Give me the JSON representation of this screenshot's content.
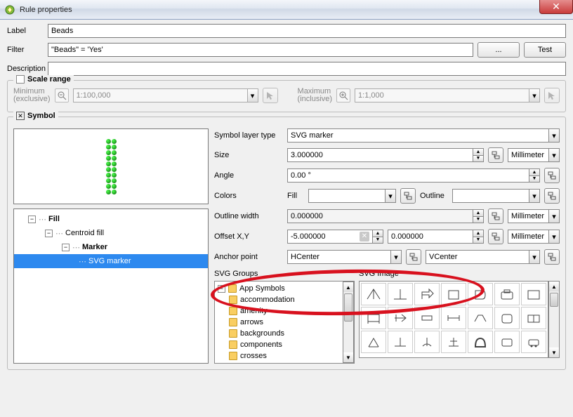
{
  "window": {
    "title": "Rule properties"
  },
  "topbtns": {
    "dots": "...",
    "test": "Test"
  },
  "labels": {
    "label": "Label",
    "filter": "Filter",
    "description": "Description",
    "scale_range": "Scale range",
    "min1": "Minimum",
    "min2": "(exclusive)",
    "max1": "Maximum",
    "max2": "(inclusive)",
    "symbol": "Symbol",
    "symbol_layer_type": "Symbol layer type",
    "size": "Size",
    "angle": "Angle",
    "colors": "Colors",
    "fill": "Fill",
    "outline": "Outline",
    "outline_width": "Outline width",
    "offset": "Offset X,Y",
    "anchor": "Anchor point",
    "svg_groups": "SVG Groups",
    "svg_image": "SVG Image"
  },
  "values": {
    "label": "Beads",
    "filter": "\"Beads\" = 'Yes'",
    "description": "",
    "scale_min": "1:100,000",
    "scale_max": "1:1,000",
    "symbol_layer_type": "SVG marker",
    "size": "3.000000",
    "angle": "0.00 °",
    "outline_width": "0.000000",
    "offset_x": "-5.000000",
    "offset_y": "0.000000",
    "anchor_h": "HCenter",
    "anchor_v": "VCenter",
    "unit": "Millimeter"
  },
  "tree": {
    "fill": "Fill",
    "centroid": "Centroid fill",
    "marker": "Marker",
    "svg_marker": "SVG marker"
  },
  "svg_groups": {
    "root": "App Symbols",
    "kids": [
      "accommodation",
      "amenity",
      "arrows",
      "backgrounds",
      "components",
      "crosses"
    ]
  }
}
